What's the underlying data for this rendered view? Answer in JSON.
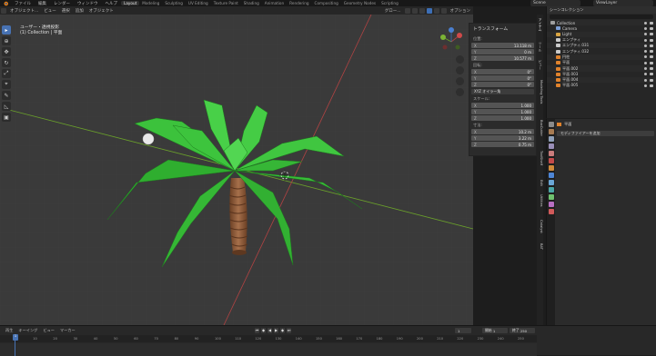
{
  "topbar": {
    "menus": [
      "ファイル",
      "編集",
      "レンダー",
      "ウィンドウ",
      "ヘルプ"
    ],
    "workspaces": [
      "Layout",
      "Modeling",
      "Sculpting",
      "UV Editing",
      "Texture Paint",
      "Shading",
      "Animation",
      "Rendering",
      "Compositing",
      "Geometry Nodes",
      "Scripting"
    ],
    "active_workspace": "Layout",
    "scene": "Scene",
    "view_layer": "ViewLayer"
  },
  "viewport_header": {
    "mode": "オブジェクト...",
    "menus": [
      "ビュー",
      "選択",
      "追加",
      "オブジェクト"
    ],
    "orientation": "グロー...",
    "options": "オプション"
  },
  "viewport_info": {
    "line1": "ユーザー・透視投影",
    "line2": "(1) Collection | 平面"
  },
  "npanel": {
    "title": "トランスフォーム",
    "location_label": "位置:",
    "location": [
      {
        "axis": "X",
        "value": "13.118 m"
      },
      {
        "axis": "Y",
        "value": "0 m"
      },
      {
        "axis": "Z",
        "value": "10.577 m"
      }
    ],
    "rotation_label": "回転:",
    "rotation": [
      {
        "axis": "X",
        "value": "0°"
      },
      {
        "axis": "Y",
        "value": "0°"
      },
      {
        "axis": "Z",
        "value": "0°"
      }
    ],
    "euler": "XYZ オイラー角",
    "scale_label": "スケール:",
    "scale": [
      {
        "axis": "X",
        "value": "1.000"
      },
      {
        "axis": "Y",
        "value": "1.000"
      },
      {
        "axis": "Z",
        "value": "1.000"
      }
    ],
    "dimensions_label": "寸法:",
    "dimensions": [
      {
        "axis": "X",
        "value": "10.2 m"
      },
      {
        "axis": "Y",
        "value": "3.22 m"
      },
      {
        "axis": "Z",
        "value": "0.75 m"
      }
    ]
  },
  "sidebar_tabs": [
    "アイテム",
    "ツール",
    "ビュー",
    "Modeling Tools",
    "BoxCutter",
    "ToolShelf",
    "Edit",
    "Utilities",
    "Catalyst",
    "BAT"
  ],
  "outliner": {
    "title": "シーンコレクション",
    "rows": [
      {
        "label": "Collection",
        "color": "#9e9e9e"
      },
      {
        "label": "Camera",
        "color": "#7c9fd6"
      },
      {
        "label": "Light",
        "color": "#d9a441"
      },
      {
        "label": "エンプティ",
        "color": "#c9c9c9"
      },
      {
        "label": "エンプティ.031",
        "color": "#c9c9c9"
      },
      {
        "label": "エンプティ.032",
        "color": "#c9c9c9"
      },
      {
        "label": "円柱",
        "color": "#e0822c"
      },
      {
        "label": "平面",
        "color": "#e0822c"
      },
      {
        "label": "平面.002",
        "color": "#e0822c"
      },
      {
        "label": "平面.003",
        "color": "#e0822c"
      },
      {
        "label": "平面.004",
        "color": "#e0822c"
      },
      {
        "label": "平面.005",
        "color": "#e0822c"
      }
    ]
  },
  "properties": {
    "object": "平面",
    "add_modifier": "モディファイアーを追加"
  },
  "timeline": {
    "menus": [
      "再生",
      "キーイング",
      "ビュー",
      "マーカー"
    ],
    "current_frame": "1",
    "start_label": "開始",
    "start": "1",
    "end_label": "終了",
    "end": "250",
    "ticks": [
      "0",
      "10",
      "20",
      "30",
      "40",
      "50",
      "60",
      "70",
      "80",
      "90",
      "100",
      "110",
      "120",
      "130",
      "140",
      "150",
      "160",
      "170",
      "180",
      "190",
      "200",
      "210",
      "220",
      "230",
      "240",
      "250"
    ]
  },
  "colors": {
    "accent": "#4772b3",
    "leaf_green": "#2fb32f",
    "trunk_brown": "#8b5a3a",
    "x_axis": "#b24343",
    "y_axis": "#6aa02b"
  }
}
